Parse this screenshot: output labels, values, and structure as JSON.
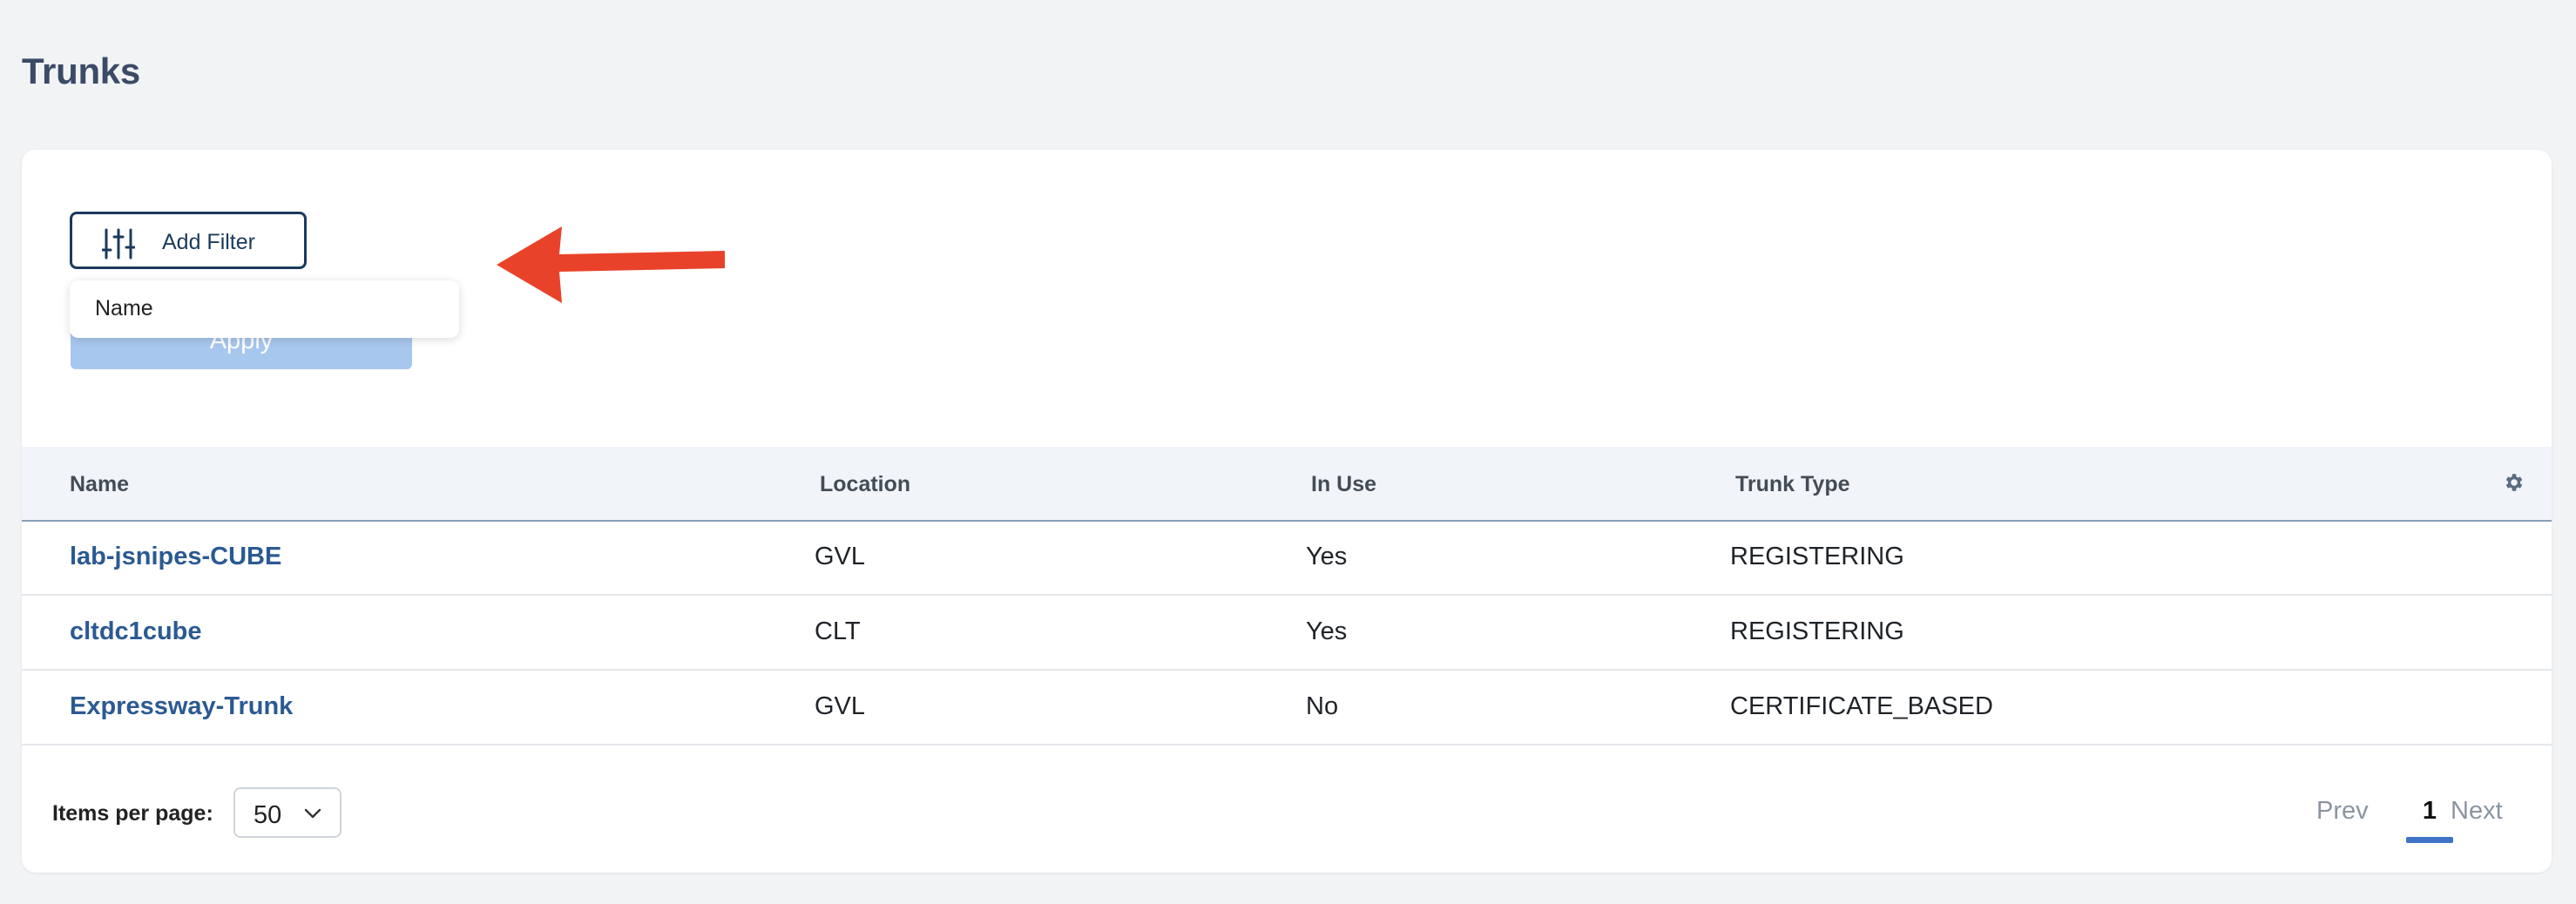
{
  "page": {
    "title": "Trunks"
  },
  "filter": {
    "add_filter_label": "Add Filter",
    "add_filter_icon": "sliders-icon",
    "apply_label": "Apply",
    "dropdown_items": [
      "Name"
    ]
  },
  "annotation": {
    "arrow_color": "#e8432a"
  },
  "table": {
    "columns": [
      "Name",
      "Location",
      "In Use",
      "Trunk Type"
    ],
    "settings_icon": "gear-icon",
    "rows": [
      {
        "name": "lab-jsnipes-CUBE",
        "location": "GVL",
        "in_use": "Yes",
        "trunk_type": "REGISTERING"
      },
      {
        "name": "cltdc1cube",
        "location": "CLT",
        "in_use": "Yes",
        "trunk_type": "REGISTERING"
      },
      {
        "name": "Expressway-Trunk",
        "location": "GVL",
        "in_use": "No",
        "trunk_type": "CERTIFICATE_BASED"
      }
    ]
  },
  "pagination": {
    "items_per_page_label": "Items per page:",
    "page_size": "50",
    "prev_label": "Prev",
    "current_page": "1",
    "next_label": "Next"
  },
  "colors": {
    "link": "#2b5a92",
    "accent": "#3f73c6",
    "apply_disabled": "#a8c7ee"
  }
}
